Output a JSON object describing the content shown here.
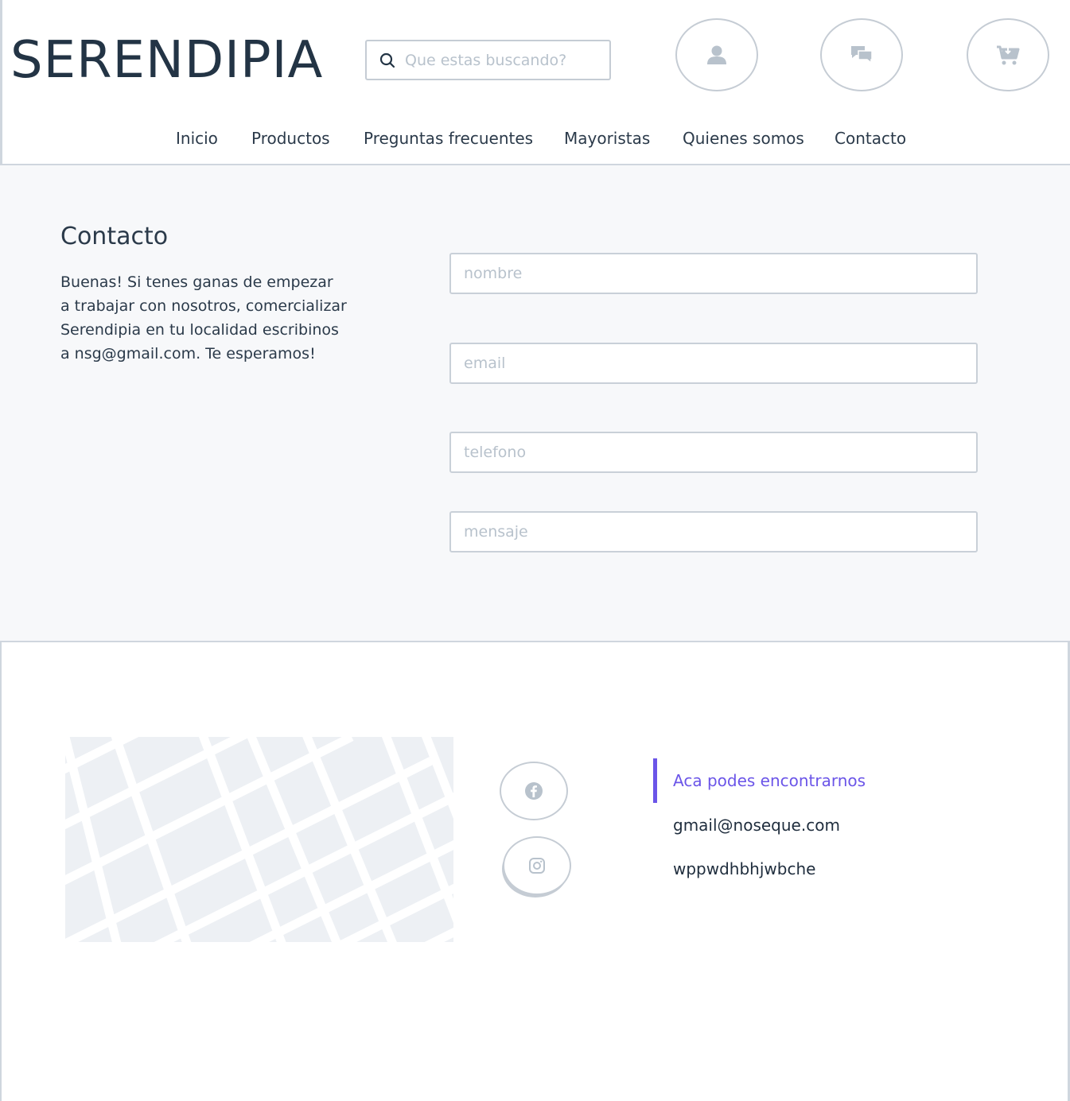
{
  "header": {
    "logo": "SERENDIPIA",
    "search_placeholder": "Que estas buscando?",
    "icons": [
      "user-icon",
      "chat-icon",
      "cart-icon"
    ]
  },
  "nav": {
    "items": [
      {
        "label": "Inicio"
      },
      {
        "label": "Productos"
      },
      {
        "label": "Preguntas frecuentes"
      },
      {
        "label": "Mayoristas"
      },
      {
        "label": "Quienes somos"
      },
      {
        "label": "Contacto"
      }
    ]
  },
  "contact": {
    "title": "Contacto",
    "text": "Buenas! Si tenes ganas de empezar a trabajar con nosotros, comercializar Serendipia en tu localidad escribinos a nsg@gmail.com. Te esperamos!",
    "fields": {
      "name_placeholder": "nombre",
      "email_placeholder": "email",
      "phone_placeholder": "telefono",
      "message_placeholder": "mensaje"
    }
  },
  "footer": {
    "social": [
      "facebook-icon",
      "instagram-icon"
    ],
    "info_title": "Aca podes encontrarnos",
    "email": "gmail@noseque.com",
    "extra": "wppwdhbhjwbche"
  },
  "colors": {
    "accent": "#6b55e8",
    "text": "#1f2d3d",
    "border": "#c5ccd4",
    "section_bg": "#f7f8fa",
    "icon": "#b8c2cc"
  }
}
